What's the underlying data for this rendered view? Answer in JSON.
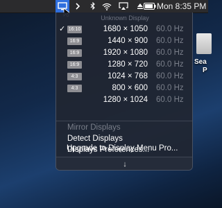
{
  "menubar": {
    "time": "Mon 8:35 PM",
    "icons": [
      "display-menu-icon",
      "chevron-right-icon",
      "bluetooth-icon",
      "wifi-icon",
      "airplay-icon",
      "eject-icon",
      "battery-icon"
    ]
  },
  "menu": {
    "header": "Unknown Display",
    "resolutions": [
      {
        "checked": "✓",
        "badge": "16:10",
        "value": "1680 × 1050",
        "hz": "60.0 Hz"
      },
      {
        "checked": "",
        "badge": "16:9",
        "value": "1440 × 900",
        "hz": "60.0 Hz"
      },
      {
        "checked": "",
        "badge": "16:9",
        "value": "1920 × 1080",
        "hz": "60.0 Hz"
      },
      {
        "checked": "",
        "badge": "16:9",
        "value": "1280 × 720",
        "hz": "60.0 Hz"
      },
      {
        "checked": "",
        "badge": "4:3",
        "value": "1024 × 768",
        "hz": "60.0 Hz"
      },
      {
        "checked": "",
        "badge": "4:3",
        "value": "800 × 600",
        "hz": "60.0 Hz"
      },
      {
        "checked": "",
        "badge": "",
        "value": "1280 × 1024",
        "hz": "60.0 Hz"
      }
    ],
    "actions": {
      "mirror": "Mirror Displays",
      "detect": "Detect Displays",
      "prefs": "Displays Preferences...",
      "upgrade": "Upgrade to Display Menu Pro..."
    },
    "scroll_glyph": "↓"
  },
  "desktop": {
    "icon_label_1": "Sea",
    "icon_label_2": "P"
  }
}
